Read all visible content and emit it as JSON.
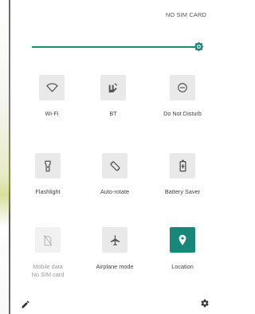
{
  "status_bar": {
    "sim_status": "NO SIM CARD"
  },
  "brightness": {
    "level": 1.0,
    "icon": "brightness-auto-icon"
  },
  "tiles": [
    {
      "label": "Wi-Fi",
      "icon": "wifi-icon",
      "state": "off"
    },
    {
      "label": "BT",
      "icon": "bluetooth-icon",
      "state": "off"
    },
    {
      "label": "Do Not Disturb",
      "icon": "do-not-disturb-icon",
      "state": "off"
    },
    {
      "label": "Flashlight",
      "icon": "flashlight-icon",
      "state": "off"
    },
    {
      "label": "Auto-rotate",
      "icon": "auto-rotate-icon",
      "state": "off"
    },
    {
      "label": "Battery Saver",
      "icon": "battery-saver-icon",
      "state": "off"
    },
    {
      "label": "Mobile data",
      "sublabel": "No SIM card",
      "icon": "mobile-data-off-icon",
      "state": "disabled"
    },
    {
      "label": "Airplane mode",
      "icon": "airplane-icon",
      "state": "off"
    },
    {
      "label": "Location",
      "icon": "location-icon",
      "state": "on"
    }
  ],
  "footer": {
    "edit_icon": "pencil-icon",
    "settings_icon": "gear-icon"
  },
  "colors": {
    "accent": "#17877a",
    "tile_off": "#e9e9e9",
    "tile_disabled": "#f1f1f1",
    "icon": "#555555"
  }
}
